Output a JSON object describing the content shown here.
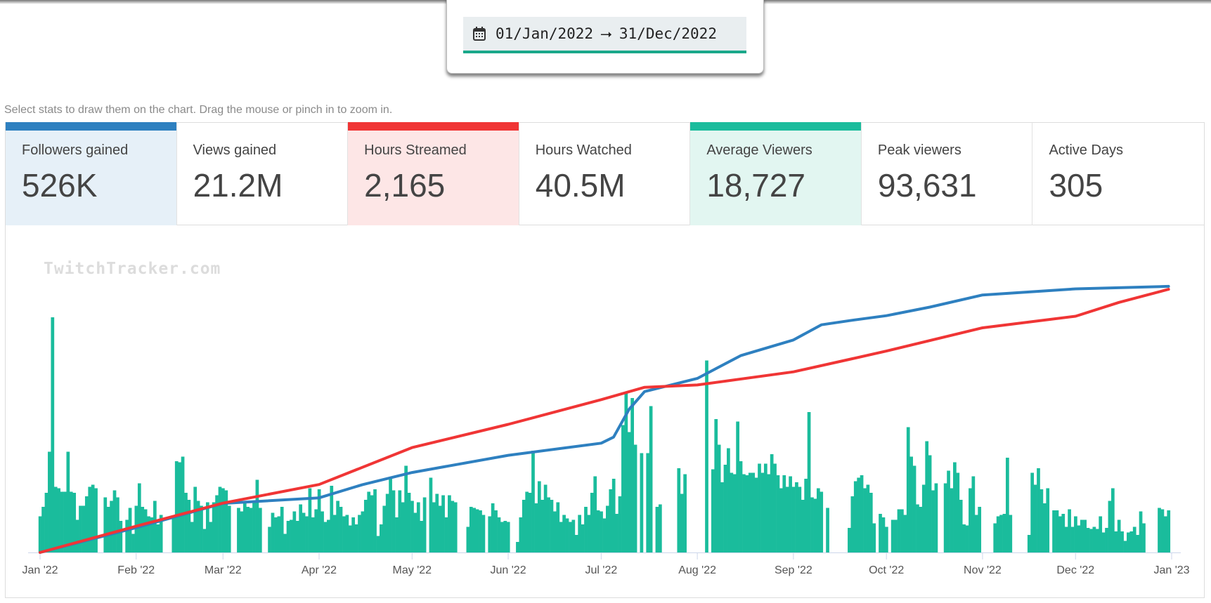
{
  "date_range": {
    "icon": "calendar-icon",
    "start": "01/Jan/2022",
    "arrow": "⭢",
    "end": "31/Dec/2022"
  },
  "hint": "Select stats to draw them on the chart. Drag the mouse or pinch in to zoom in.",
  "stats": [
    {
      "label": "Followers gained",
      "value": "526K",
      "selected": true,
      "color": "#2e80c0",
      "bg": "#e6f0f8"
    },
    {
      "label": "Views gained",
      "value": "21.2M",
      "selected": false
    },
    {
      "label": "Hours Streamed",
      "value": "2,165",
      "selected": true,
      "color": "#f03535",
      "bg": "#fde6e6"
    },
    {
      "label": "Hours Watched",
      "value": "40.5M",
      "selected": false
    },
    {
      "label": "Average Viewers",
      "value": "18,727",
      "selected": true,
      "color": "#1abc9c",
      "bg": "#e2f6f1"
    },
    {
      "label": "Peak viewers",
      "value": "93,631",
      "selected": false
    },
    {
      "label": "Active Days",
      "value": "305",
      "selected": false
    }
  ],
  "watermark": "TwitchTracker.com",
  "chart_data": {
    "type": "bar+line",
    "x_start": "2022-01-01",
    "xlim": [
      "2022-01-01",
      "2023-01-01"
    ],
    "x_ticks": [
      {
        "date": "2022-01-01",
        "label": "Jan '22"
      },
      {
        "date": "2022-02-01",
        "label": "Feb '22"
      },
      {
        "date": "2022-03-01",
        "label": "Mar '22"
      },
      {
        "date": "2022-04-01",
        "label": "Apr '22"
      },
      {
        "date": "2022-05-01",
        "label": "May '22"
      },
      {
        "date": "2022-06-01",
        "label": "Jun '22"
      },
      {
        "date": "2022-07-01",
        "label": "Jul '22"
      },
      {
        "date": "2022-08-01",
        "label": "Aug '22"
      },
      {
        "date": "2022-09-01",
        "label": "Sep '22"
      },
      {
        "date": "2022-10-01",
        "label": "Oct '22"
      },
      {
        "date": "2022-11-01",
        "label": "Nov '22"
      },
      {
        "date": "2022-12-01",
        "label": "Dec '22"
      },
      {
        "date": "2023-01-01",
        "label": "Jan '23"
      }
    ],
    "grid": false,
    "bars": {
      "stat": "Average Viewers",
      "color": "#1abc9c",
      "ylim": [
        0,
        80000
      ],
      "daily_values": [
        10300,
        13000,
        17000,
        28700,
        67000,
        18700,
        18300,
        17300,
        17300,
        28700,
        17300,
        17000,
        9300,
        13300,
        13300,
        16000,
        18700,
        19300,
        18300,
        0,
        0,
        15700,
        13000,
        14700,
        17700,
        15700,
        9000,
        0,
        9300,
        12700,
        5300,
        13300,
        19700,
        13000,
        12300,
        10300,
        10000,
        14700,
        8000,
        10700,
        0,
        0,
        0,
        10300,
        26000,
        25700,
        27300,
        17000,
        15000,
        8700,
        18700,
        14700,
        13300,
        6700,
        14300,
        8700,
        14300,
        16300,
        18700,
        18300,
        17700,
        13300,
        0,
        0,
        12700,
        11700,
        14300,
        13000,
        12700,
        14300,
        20700,
        12700,
        0,
        0,
        7300,
        11300,
        10000,
        10300,
        13000,
        5300,
        9000,
        9300,
        11700,
        9000,
        13700,
        11300,
        10300,
        18300,
        10000,
        12300,
        18000,
        11700,
        8700,
        9300,
        19000,
        10700,
        14700,
        13000,
        10300,
        10700,
        7700,
        10000,
        8000,
        10700,
        11700,
        15000,
        17300,
        16300,
        18000,
        4700,
        8000,
        13300,
        16700,
        21000,
        17700,
        10000,
        17700,
        14300,
        24700,
        17000,
        14700,
        11300,
        14300,
        9000,
        15700,
        0,
        21300,
        14300,
        16700,
        13300,
        16300,
        10000,
        16300,
        14700,
        14300,
        0,
        0,
        0,
        7300,
        13000,
        12700,
        12300,
        12000,
        10700,
        0,
        10300,
        14000,
        12000,
        10000,
        8700,
        9000,
        8700,
        0,
        0,
        3000,
        10000,
        15000,
        17300,
        17000,
        29000,
        14000,
        20300,
        15000,
        19300,
        15700,
        15000,
        11700,
        14300,
        8700,
        10700,
        9700,
        8700,
        9300,
        5000,
        10700,
        8000,
        13000,
        10700,
        17000,
        21700,
        12000,
        11700,
        9700,
        13300,
        18000,
        21000,
        11000,
        16000,
        36300,
        45300,
        34300,
        44000,
        30700,
        0,
        28300,
        0,
        28300,
        41700,
        0,
        13000,
        13700,
        0,
        0,
        0,
        0,
        0,
        24000,
        16700,
        22300,
        0,
        0,
        0,
        0,
        0,
        0,
        54700,
        0,
        23700,
        38000,
        30700,
        20000,
        25000,
        29700,
        22700,
        22300,
        37300,
        26000,
        22300,
        22000,
        22700,
        22700,
        21300,
        25300,
        22700,
        25300,
        22300,
        28000,
        25300,
        22000,
        18300,
        22000,
        18700,
        21700,
        18700,
        20000,
        18700,
        15000,
        21000,
        40000,
        15700,
        15300,
        18300,
        17300,
        0,
        12700,
        0,
        0,
        0,
        0,
        0,
        0,
        7000,
        16000,
        20300,
        21300,
        22000,
        18300,
        19300,
        17000,
        8300,
        0,
        11000,
        10000,
        7300,
        0,
        9300,
        9300,
        12300,
        12300,
        10700,
        35700,
        27300,
        24700,
        13700,
        13000,
        19300,
        31700,
        27700,
        17700,
        19700,
        0,
        0,
        19700,
        23300,
        18300,
        25700,
        22700,
        15000,
        8000,
        7700,
        18300,
        21700,
        10700,
        13000,
        0,
        0,
        0,
        0,
        8300,
        10300,
        10700,
        11000,
        27000,
        10700,
        0,
        0,
        0,
        0,
        0,
        5000,
        22700,
        19300,
        24000,
        18000,
        14000,
        18300,
        0,
        12000,
        12000,
        10300,
        11000,
        7300,
        12300,
        7300,
        10300,
        7700,
        9300,
        9300,
        7000,
        6700,
        7300,
        6700,
        10300,
        5700,
        7000,
        14700,
        18300,
        6000,
        9300,
        6000,
        3300,
        5700,
        6000,
        7300,
        5000,
        11700,
        8300,
        0,
        0,
        0,
        0,
        12700,
        12300,
        10300,
        12000
      ]
    },
    "lines": [
      {
        "stat": "Followers gained",
        "color": "#2e80c0",
        "ylim": [
          0,
          555000
        ],
        "points": [
          [
            "2022-01-01",
            0
          ],
          [
            "2022-02-01",
            49000
          ],
          [
            "2022-03-01",
            97000
          ],
          [
            "2022-04-01",
            108000
          ],
          [
            "2022-04-15",
            134000
          ],
          [
            "2022-05-01",
            158000
          ],
          [
            "2022-06-01",
            192000
          ],
          [
            "2022-07-01",
            216000
          ],
          [
            "2022-07-05",
            228000
          ],
          [
            "2022-07-10",
            283000
          ],
          [
            "2022-07-15",
            318000
          ],
          [
            "2022-08-01",
            344000
          ],
          [
            "2022-08-15",
            389000
          ],
          [
            "2022-09-01",
            420000
          ],
          [
            "2022-09-10",
            450000
          ],
          [
            "2022-09-20",
            459000
          ],
          [
            "2022-10-01",
            468000
          ],
          [
            "2022-10-15",
            485000
          ],
          [
            "2022-11-01",
            509000
          ],
          [
            "2022-12-01",
            521000
          ],
          [
            "2022-12-31",
            526000
          ]
        ]
      },
      {
        "stat": "Hours Streamed",
        "color": "#f03535",
        "ylim": [
          0,
          2310
        ],
        "points": [
          [
            "2022-01-01",
            0
          ],
          [
            "2022-02-01",
            216
          ],
          [
            "2022-03-01",
            406
          ],
          [
            "2022-04-01",
            559
          ],
          [
            "2022-05-01",
            863
          ],
          [
            "2022-06-01",
            1054
          ],
          [
            "2022-07-01",
            1257
          ],
          [
            "2022-07-15",
            1359
          ],
          [
            "2022-08-01",
            1378
          ],
          [
            "2022-09-01",
            1486
          ],
          [
            "2022-09-20",
            1594
          ],
          [
            "2022-10-01",
            1657
          ],
          [
            "2022-11-01",
            1848
          ],
          [
            "2022-12-01",
            1943
          ],
          [
            "2022-12-15",
            2057
          ],
          [
            "2022-12-31",
            2165
          ]
        ]
      }
    ]
  }
}
